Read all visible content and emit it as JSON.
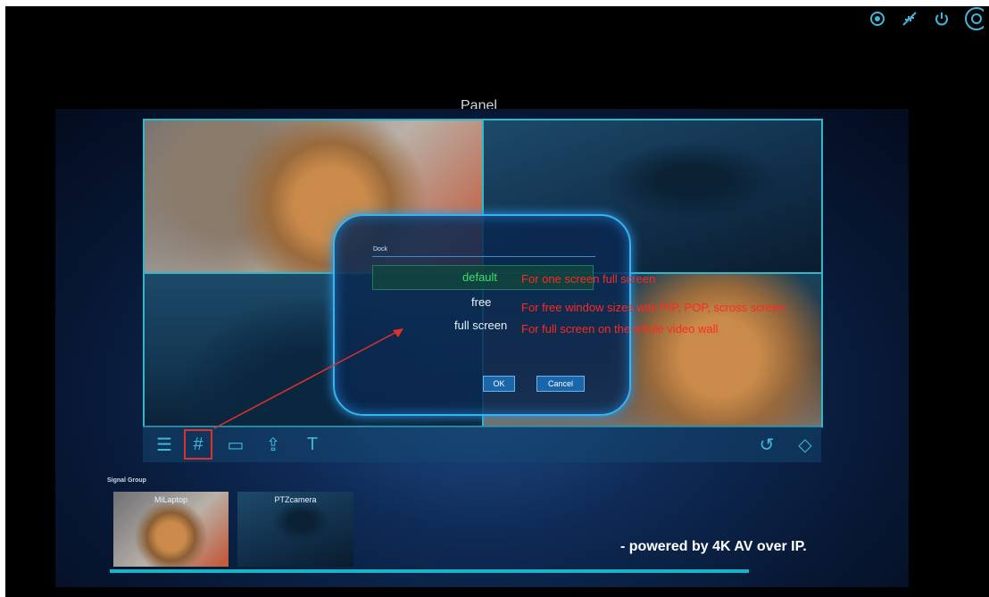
{
  "top_icons": [
    "signal-icon",
    "shrink-icon",
    "power-icon",
    "settings-wheel-icon"
  ],
  "panel": {
    "title": "Panel"
  },
  "dialog": {
    "title": "Dock",
    "options": [
      "default",
      "free",
      "full screen"
    ],
    "selected": "default",
    "ok_label": "OK",
    "cancel_label": "Cancel"
  },
  "annotations": {
    "default": "For one screen full screen",
    "free": "For free window sizes with PIP, POP, scross screen",
    "full_screen": "For full screen on the whole video wall"
  },
  "toolbar": {
    "items": [
      "menu-icon",
      "grid-icon",
      "layout-icon",
      "export-icon",
      "text-icon"
    ],
    "right_items": [
      "undo-icon",
      "eraser-icon"
    ],
    "selected": "grid-icon"
  },
  "signal_group": {
    "title": "Signal Group",
    "sources": [
      "MiLaptop",
      "PTZcamera"
    ]
  },
  "footer": {
    "powered": "- powered by 4K AV over IP."
  },
  "colors": {
    "accent": "#2fb8c9",
    "annotation": "#ff2a1f",
    "selected_option": "#36e36b"
  }
}
